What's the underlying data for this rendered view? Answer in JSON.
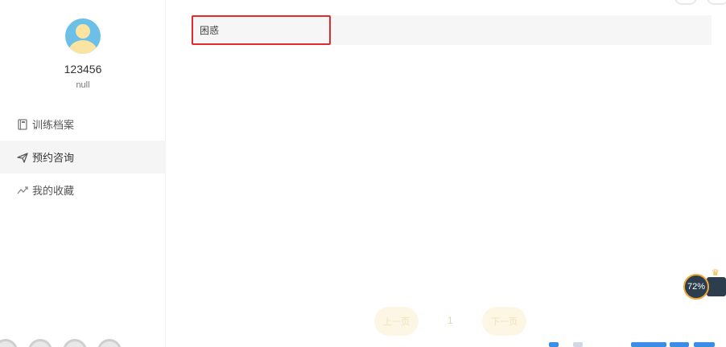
{
  "profile": {
    "username": "123456",
    "subtitle": "null"
  },
  "nav": {
    "items": [
      {
        "label": "训练档案",
        "icon": "notebook-icon"
      },
      {
        "label": "预约咨询",
        "icon": "paper-plane-icon"
      },
      {
        "label": "我的收藏",
        "icon": "trend-icon"
      }
    ],
    "active_index": 1
  },
  "list": {
    "items": [
      {
        "label": "困惑"
      }
    ]
  },
  "pagination": {
    "prev_label": "上一页",
    "current_page": "1",
    "next_label": "下一页"
  },
  "widget": {
    "percent": "72%"
  },
  "colors": {
    "highlight_border": "#e22a2a",
    "pager_bg": "#fdf6e4",
    "active_nav_bg": "#f5f5f5"
  }
}
